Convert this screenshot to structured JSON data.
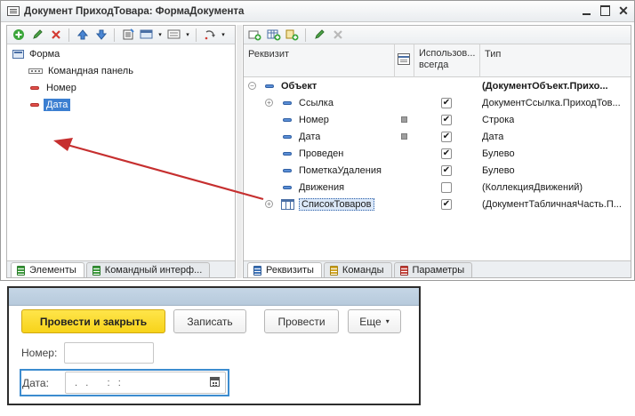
{
  "window": {
    "title": "Документ ПриходТовара: ФормаДокумента"
  },
  "left_tree": {
    "items": [
      {
        "label": "Форма",
        "icon": "form-icon"
      },
      {
        "label": "Командная панель",
        "icon": "command-panel-icon"
      },
      {
        "label": "Номер",
        "icon": "field-icon"
      },
      {
        "label": "Дата",
        "icon": "field-icon",
        "selected": true
      }
    ]
  },
  "left_tabs": [
    "Элементы",
    "Командный интерф..."
  ],
  "right_table": {
    "columns": {
      "attr": "Реквизит",
      "use_always": "Использов... всегда",
      "type": "Тип"
    },
    "rows": [
      {
        "name": "Объект",
        "type": "(ДокументОбъект.Прихо...",
        "bold": true,
        "check": "",
        "mark": false
      },
      {
        "name": "Ссылка",
        "type": "ДокументСсылка.ПриходТов...",
        "check": "✔",
        "mark": false
      },
      {
        "name": "Номер",
        "type": "Строка",
        "check": "✔",
        "mark": true
      },
      {
        "name": "Дата",
        "type": "Дата",
        "check": "✔",
        "mark": true
      },
      {
        "name": "Проведен",
        "type": "Булево",
        "check": "✔",
        "mark": false
      },
      {
        "name": "ПометкаУдаления",
        "type": "Булево",
        "check": "✔",
        "mark": false
      },
      {
        "name": "Движения",
        "type": "(КоллекцияДвижений)",
        "check": "",
        "mark": false
      },
      {
        "name": "СписокТоваров",
        "type": "(ДокументТабличнаяЧасть.П...",
        "check": "✔",
        "mark": false
      }
    ]
  },
  "right_tabs": [
    "Реквизиты",
    "Команды",
    "Параметры"
  ],
  "preview": {
    "buttons": {
      "post_close": "Провести и закрыть",
      "save": "Записать",
      "post": "Провести",
      "more": "Еще"
    },
    "fields": {
      "number_label": "Номер:",
      "number_value": "",
      "date_label": "Дата:",
      "date_value": " .  .     :  :"
    }
  },
  "colors": {
    "selection": "#3c7fd1",
    "default_button": "#f7d31a",
    "arrow": "#c62f2f",
    "focus_border": "#3c8ccf"
  }
}
